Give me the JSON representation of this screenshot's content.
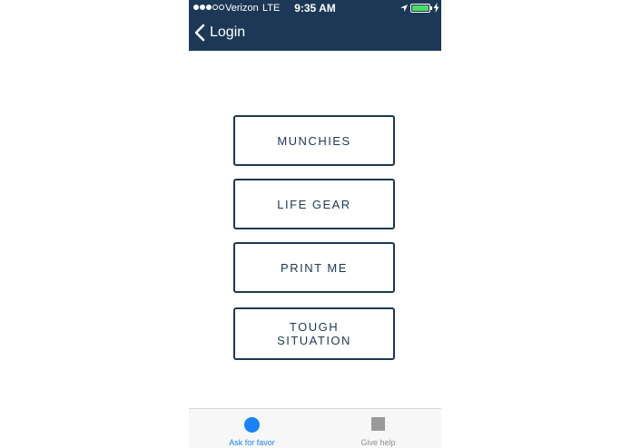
{
  "status_bar": {
    "carrier": "Verizon",
    "network": "LTE",
    "time": "9:35 AM",
    "signal_bars_filled": 3,
    "signal_bars_total": 5,
    "battery_level": 1.0,
    "battery_color": "#4cd964"
  },
  "nav": {
    "back_label": "Login",
    "back_icon": "chevron-left-icon",
    "background_color": "#1c3856"
  },
  "menu": {
    "items": [
      {
        "label": "MUNCHIES"
      },
      {
        "label": "LIFE GEAR"
      },
      {
        "label": "PRINT ME"
      },
      {
        "label": "TOUGH\nSITUATION"
      }
    ],
    "accent_color": "#1c3856"
  },
  "tab_bar": {
    "tabs": [
      {
        "label": "Ask for favor",
        "icon": "circle-icon",
        "active": true
      },
      {
        "label": "Give help",
        "icon": "square-icon",
        "active": false
      }
    ],
    "active_color": "#1a82f7",
    "inactive_color": "#8e8e8e"
  }
}
